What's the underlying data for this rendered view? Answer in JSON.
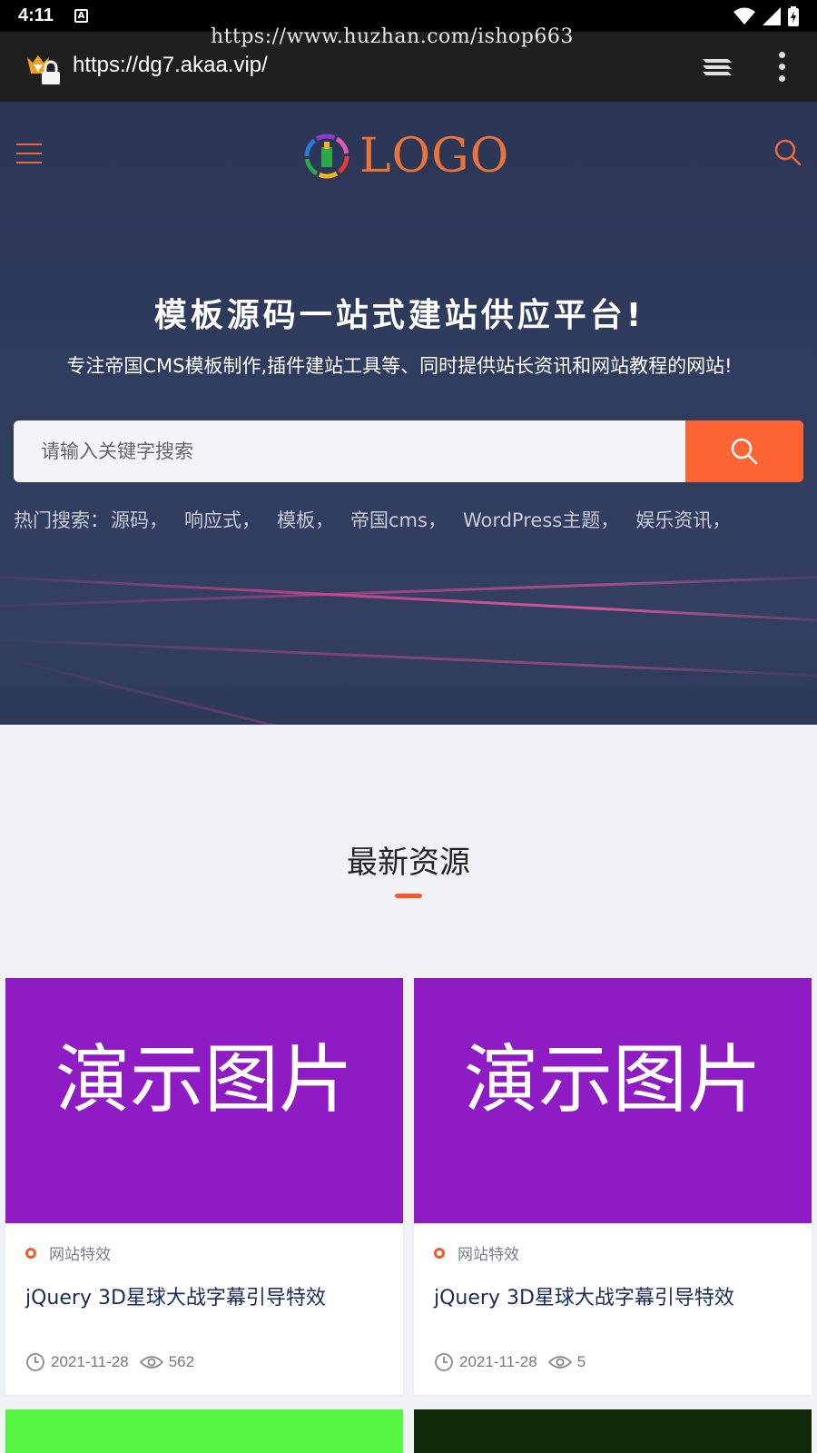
{
  "status_bar": {
    "time": "4:11",
    "notification_badge": "A"
  },
  "browser": {
    "url": "https://dg7.akaa.vip/",
    "watermark": "https://www.huzhan.com/ishop663"
  },
  "header": {
    "logo_text": "LOGO"
  },
  "hero": {
    "title": "模板源码一站式建站供应平台!",
    "subtitle": "专注帝国CMS模板制作,插件建站工具等、同时提供站长资讯和网站教程的网站!",
    "search_placeholder": "请输入关键字搜索",
    "hot_label": "热门搜索：",
    "hot_terms": [
      "源码，",
      "响应式，",
      "模板，",
      "帝国cms，",
      "WordPress主题，",
      "娱乐资讯，"
    ]
  },
  "section": {
    "title": "最新资源"
  },
  "cards": [
    {
      "thumb_text": "演示图片",
      "category": "网站特效",
      "title": "jQuery 3D星球大战字幕引导特效",
      "date": "2021-11-28",
      "views": "562"
    },
    {
      "thumb_text": "演示图片",
      "category": "网站特效",
      "title": "jQuery 3D星球大战字幕引导特效",
      "date": "2021-11-28",
      "views": "5"
    }
  ],
  "colors": {
    "accent": "#ff6434",
    "card_thumb": "#8f1bc4",
    "next_card_left": "#56f542",
    "next_card_right": "#0f2a07",
    "hero_bg": "#2f3c5e"
  },
  "icons": [
    "menu-icon",
    "search-icon",
    "tabs-icon",
    "more-icon",
    "clock-icon",
    "eye-icon",
    "wifi-icon",
    "signal-icon",
    "battery-icon"
  ]
}
